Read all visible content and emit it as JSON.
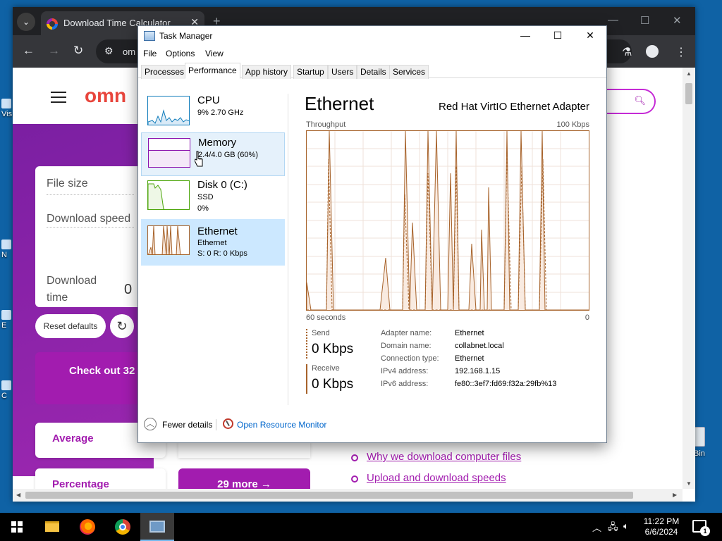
{
  "desktop": {
    "icon_labels": [
      "Vis",
      "N",
      "E",
      "C"
    ],
    "recycle_bin_label": "Bin"
  },
  "browser": {
    "tab_title": "Download Time Calculator",
    "url_partial": "om",
    "page": {
      "logo_text": "omn",
      "calc_fields": {
        "file_size_label": "File size",
        "download_speed_label": "Download speed",
        "download_time_label_1": "Download",
        "download_time_label_2": "time",
        "download_time_value": "0"
      },
      "reset_button": "Reset defaults",
      "checkout_text": "Check out 32",
      "average_label": "Average",
      "percentage_label": "Percentage",
      "more_button": "29 more",
      "links": [
        "Why we download computer files",
        "Upload and download speeds",
        "... ... ... ..."
      ]
    }
  },
  "task_manager": {
    "title": "Task Manager",
    "menu": [
      "File",
      "Options",
      "View"
    ],
    "tabs": [
      "Processes",
      "Performance",
      "App history",
      "Startup",
      "Users",
      "Details",
      "Services"
    ],
    "active_tab": "Performance",
    "resources": [
      {
        "name": "CPU",
        "line1": "9% 2.70 GHz",
        "line2": ""
      },
      {
        "name": "Memory",
        "line1": "2.4/4.0 GB (60%)",
        "line2": ""
      },
      {
        "name": "Disk 0 (C:)",
        "line1": "SSD",
        "line2": "0%"
      },
      {
        "name": "Ethernet",
        "line1": "Ethernet",
        "line2": "S: 0 R: 0 Kbps"
      }
    ],
    "detail": {
      "title": "Ethernet",
      "adapter": "Red Hat VirtIO Ethernet Adapter",
      "graph_label": "Throughput",
      "graph_max": "100 Kbps",
      "time_label": "60 seconds",
      "time_zero": "0",
      "send_label": "Send",
      "send_value": "0 Kbps",
      "receive_label": "Receive",
      "receive_value": "0 Kbps",
      "info": [
        {
          "key": "Adapter name:",
          "value": "Ethernet"
        },
        {
          "key": "Domain name:",
          "value": "collabnet.local"
        },
        {
          "key": "Connection type:",
          "value": "Ethernet"
        },
        {
          "key": "IPv4 address:",
          "value": "192.168.1.15"
        },
        {
          "key": "IPv6 address:",
          "value": "fe80::3ef7:fd69:f32a:29fb%13"
        }
      ]
    },
    "footer": {
      "fewer_details": "Fewer details",
      "open_resource_monitor": "Open Resource Monitor"
    }
  },
  "taskbar": {
    "time": "11:22 PM",
    "date": "6/6/2024",
    "notification_count": "1"
  },
  "colors": {
    "chrome_dark": "#202124",
    "ethernet_line": "#a7632b",
    "memory_line": "#8b12ae",
    "disk_line": "#4da60c",
    "cpu_line": "#117dbb",
    "selection": "#cce8ff",
    "site_accent": "#a21caf"
  }
}
